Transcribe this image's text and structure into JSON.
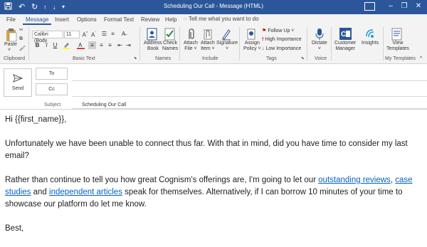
{
  "window": {
    "title": "Scheduling Our Call  -  Message (HTML)",
    "restore_icon": "restore-window-icon",
    "minimize_icon": "minimize-icon",
    "maximize_icon": "maximize-icon",
    "close_icon": "close-icon"
  },
  "ribbon_tabs": [
    "File",
    "Message",
    "Insert",
    "Options",
    "Format Text",
    "Review",
    "Help"
  ],
  "active_tab": "Message",
  "tell_me": "Tell me what you want to do",
  "clipboard": {
    "paste": "Paste",
    "label": "Clipboard"
  },
  "basic_text": {
    "font": "Calibri (Body",
    "size": "11",
    "label": "Basic Text"
  },
  "names": {
    "address_book": [
      "Address",
      "Book"
    ],
    "check_names": [
      "Check",
      "Names"
    ],
    "label": "Names"
  },
  "include": {
    "attach_file": [
      "Attach",
      "File ˅"
    ],
    "attach_item": [
      "Attach",
      "Item ˅"
    ],
    "signature": [
      "Signature",
      "˅"
    ],
    "label": "Include"
  },
  "tags": {
    "assign_policy": [
      "Assign",
      "Policy ˅"
    ],
    "follow_up": "Follow Up ˅",
    "high_importance": "High Importance",
    "low_importance": "Low Importance",
    "label": "Tags"
  },
  "voice": {
    "dictate": [
      "Dictate",
      "˅"
    ],
    "label": "Voice"
  },
  "addins": {
    "customer_manager": [
      "Customer",
      "Manager"
    ],
    "insights": "Insights"
  },
  "my_templates": {
    "view_templates": [
      "View",
      "Templates"
    ],
    "label": "My Templates"
  },
  "compose": {
    "send": "Send",
    "to": "To",
    "cc": "Cc",
    "subject_label": "Subject",
    "subject": "Scheduling Our Call"
  },
  "body": {
    "greeting": "Hi {{first_name}},",
    "para1": "Unfortunately we have been unable to connect thus far. With that in mind, did you have time to consider my last email?",
    "para2_a": "Rather than continue to tell you how great Cognism's offerings are, I'm going to let our ",
    "link1": "outstanding reviews",
    "para2_b": ", ",
    "link2": "case studies",
    "para2_c": " and ",
    "link3": "independent articles",
    "para2_d": " speak for themselves. Alternatively, if I can borrow 10 minutes of your time to showcase our platform do let me know.",
    "signoff": "Best,"
  },
  "colors": {
    "title_bar": "#2b579a",
    "ribbon": "#f3f3f3",
    "link": "#0563c1",
    "follow_up_flag": "#c00000"
  }
}
